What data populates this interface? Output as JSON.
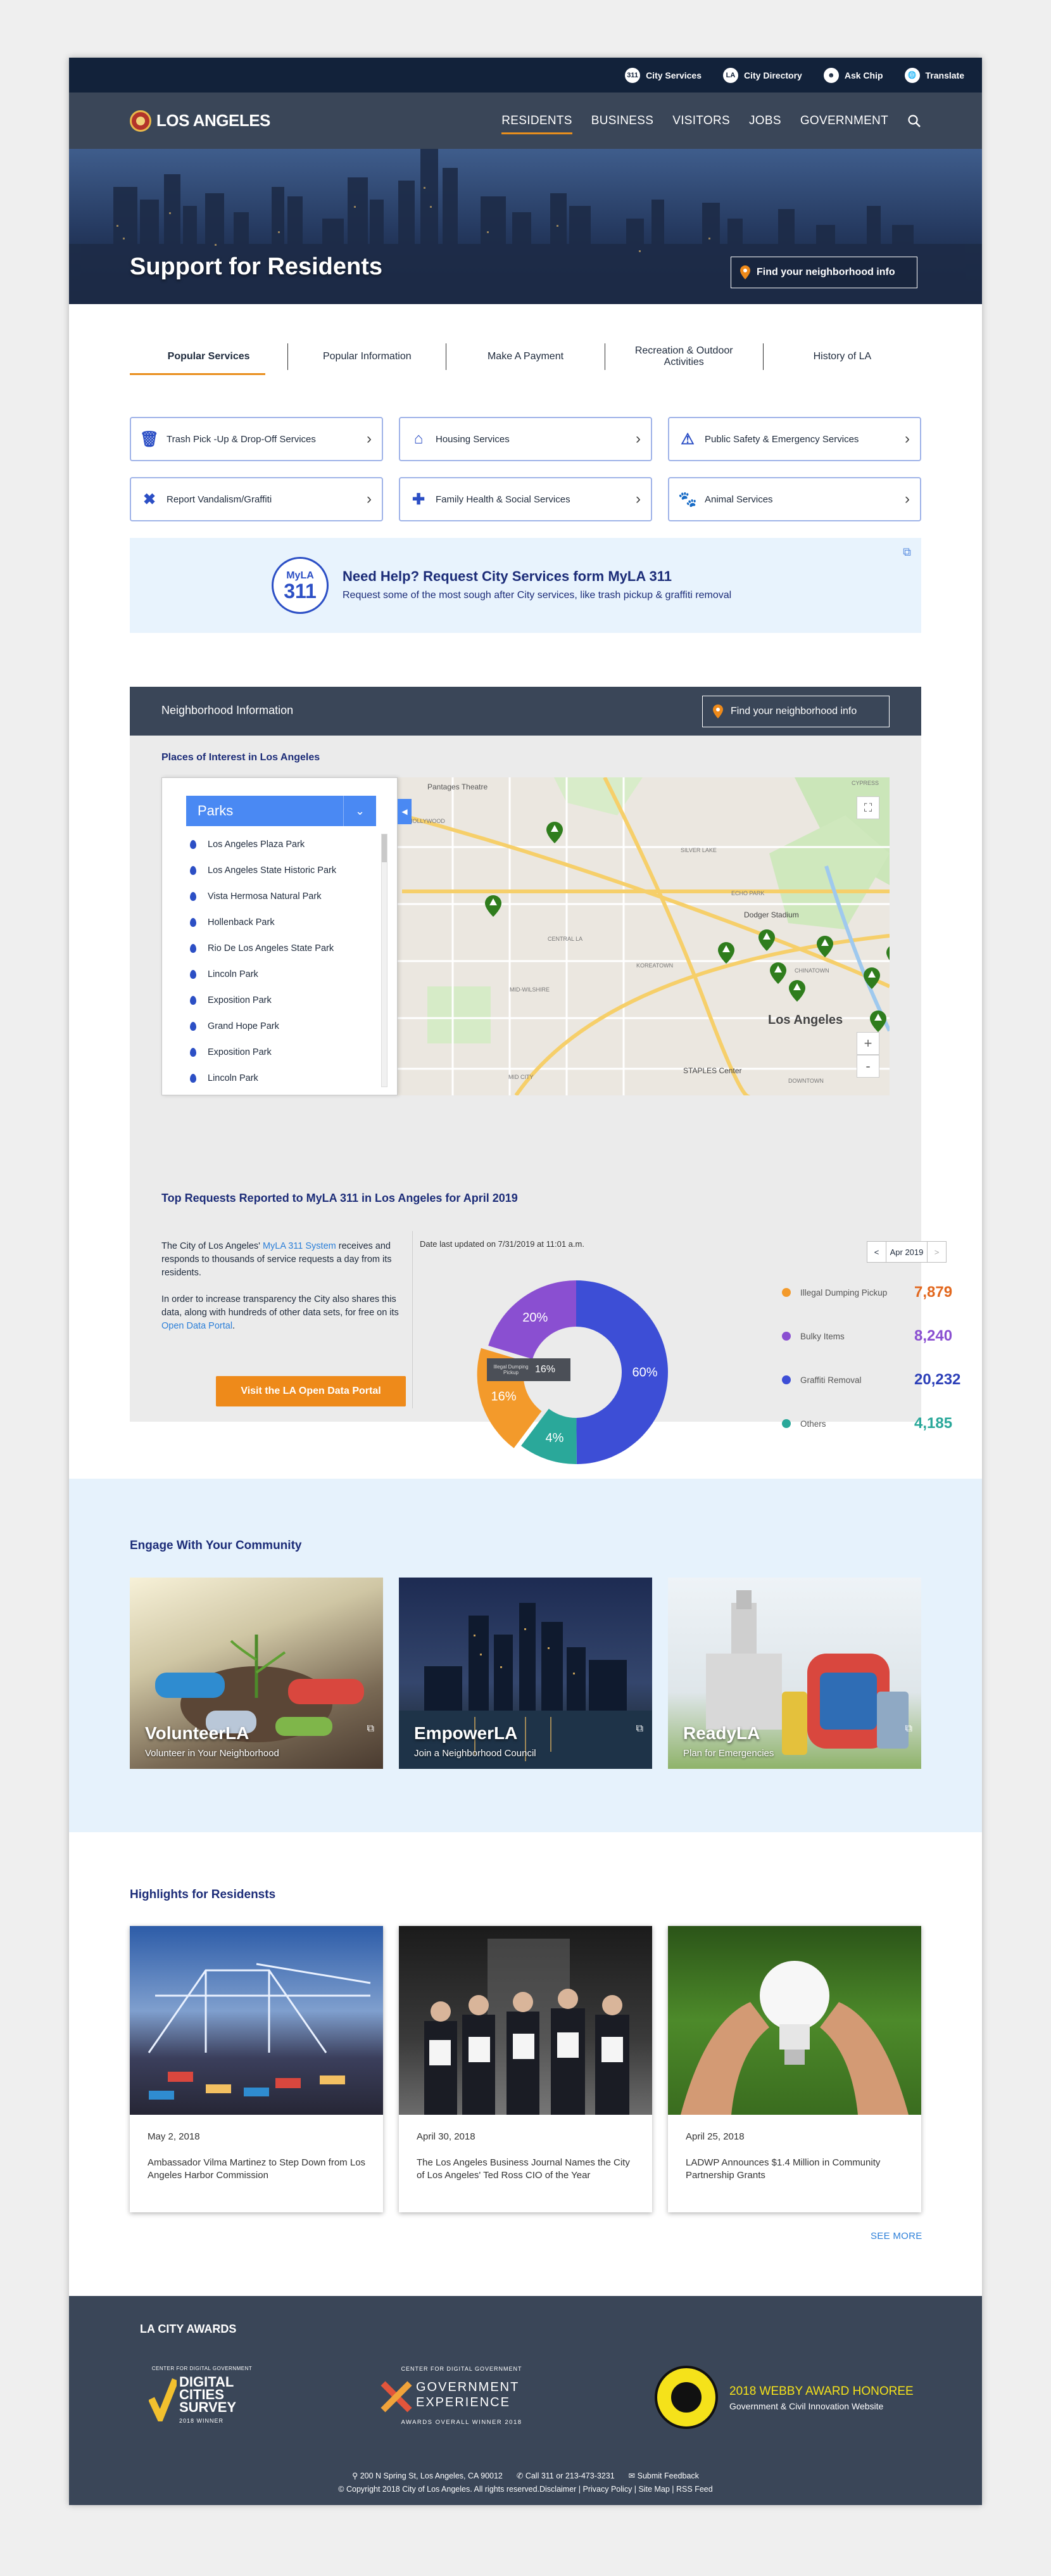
{
  "utility": {
    "links": [
      {
        "icon": "311-icon",
        "glyph": "311",
        "label": "City Services"
      },
      {
        "icon": "city-directory-icon",
        "glyph": "LA",
        "label": "City Directory"
      },
      {
        "icon": "chip-icon",
        "glyph": "☻",
        "label": "Ask Chip"
      },
      {
        "icon": "globe-icon",
        "glyph": "🌐",
        "label": "Translate"
      }
    ]
  },
  "header": {
    "logo_text": "LOS ANGELES",
    "nav": [
      "RESIDENTS",
      "BUSINESS",
      "VISITORS",
      "JOBS",
      "GOVERNMENT"
    ],
    "active_nav": "RESIDENTS"
  },
  "hero": {
    "title": "Support for Residents",
    "button_label": "Find your neighborhood info"
  },
  "tabs": [
    "Popular Services",
    "Popular Information",
    "Make A Payment",
    "Recreation & Outdoor Activities",
    "History of LA"
  ],
  "services": [
    {
      "label": "Trash Pick -Up & Drop-Off Services",
      "icon": "trash-icon"
    },
    {
      "label": "Housing Services",
      "icon": "house-icon"
    },
    {
      "label": "Public Safety & Emergency Services",
      "icon": "warning-icon"
    },
    {
      "label": "Report Vandalism/Graffiti",
      "icon": "x-icon"
    },
    {
      "label": "Family Health & Social Services",
      "icon": "plus-icon"
    },
    {
      "label": "Animal Services",
      "icon": "paw-icon"
    }
  ],
  "myla": {
    "logo_top": "MyLA",
    "logo_num": "311",
    "title": "Need Help? Request City Services form MyLA 311",
    "subtitle": "Request some of the most sough after City services, like trash pickup & graffiti removal"
  },
  "neighborhood": {
    "title": "Neighborhood Information",
    "button_label": "Find your neighborhood info",
    "poi_title": "Places of Interest in Los Angeles",
    "selected_category": "Parks",
    "parks": [
      "Los Angeles Plaza Park",
      "Los Angeles State Historic Park",
      "Vista Hermosa Natural Park",
      "Hollenback Park",
      "Rio De Los Angeles State Park",
      "Lincoln Park",
      "Exposition Park",
      "Grand Hope Park",
      "Exposition Park",
      "Lincoln Park"
    ],
    "map_labels": {
      "city": "Los Angeles",
      "pantages": "Pantages Theatre",
      "dodger": "Dodger Stadium",
      "staples": "STAPLES Center",
      "hollywood": "HOLLYWOOD",
      "koreatown": "KOREATOWN",
      "silverlake": "SILVER LAKE",
      "echopark": "ECHO PARK",
      "chinatown": "CHINATOWN",
      "cypress": "CYPRESS",
      "central": "CENTRAL LA",
      "midcity": "MID CITY",
      "wilshire": "MID-WILSHIRE",
      "downtown": "DOWNTOWN"
    }
  },
  "requests": {
    "title": "Top Requests Reported to MyLA 311 in Los Angeles for April 2019",
    "p1_a": "The City of Los Angeles' ",
    "p1_link": "MyLA 311 System",
    "p1_b": " receives and responds to thousands of service requests a day from its residents.",
    "p2_a": "In order to increase transparency the City also shares this data, along with hundreds of other data sets, for free on its ",
    "p2_link": "Open Data Portal",
    "p2_b": ".",
    "button_label": "Visit the LA Open Data Portal",
    "date_note": "Date last updated on 7/31/2019 at 11:01 a.m.",
    "month": "Apr 2019",
    "tooltip_label": "Illegal Dumping Pickup",
    "tooltip_value": "16%"
  },
  "chart_data": {
    "type": "pie",
    "title": "",
    "categories": [
      "Illegal Dumping Pickup",
      "Bulky Items",
      "Graffiti Removal",
      "Others"
    ],
    "values": [
      7879,
      8240,
      20232,
      4185
    ],
    "percent_labels": [
      "16%",
      "20%",
      "60%",
      "4%"
    ],
    "colors": [
      "#f39a2b",
      "#8a4fd1",
      "#3d4ed6",
      "#2aa89a"
    ]
  },
  "engage": {
    "title": "Engage With Your Community",
    "cards": [
      {
        "name": "VolunteerLA",
        "sub": "Volunteer in Your Neighborhood"
      },
      {
        "name": "EmpowerLA",
        "sub": "Join a Neighborhood Council"
      },
      {
        "name": "ReadyLA",
        "sub": "Plan for Emergencies"
      }
    ]
  },
  "highlights": {
    "title": "Highlights for Residensts",
    "cards": [
      {
        "date": "May 2, 2018",
        "text": "Ambassador Vilma Martinez to Step Down from Los Angeles Harbor Commission"
      },
      {
        "date": "April 30, 2018",
        "text": "The Los Angeles Business Journal Names the City of Los Angeles' Ted Ross CIO of the Year"
      },
      {
        "date": "April 25, 2018",
        "text": "LADWP Announces $1.4 Million in Community Partnership Grants"
      }
    ],
    "see_more": "SEE MORE"
  },
  "footer": {
    "awards_title": "LA CITY AWARDS",
    "award1": {
      "top": "CENTER FOR DIGITAL GOVERNMENT",
      "line1": "DIGITAL",
      "line2": "CITIES",
      "line3": "SURVEY",
      "year": "2018 WINNER"
    },
    "award2": {
      "top": "CENTER FOR DIGITAL GOVERNMENT",
      "line1": "GOVERNMENT",
      "line2": "EXPERIENCE",
      "bottom": "AWARDS OVERALL WINNER 2018"
    },
    "award3": {
      "title": "2018 WEBBY AWARD HONOREE",
      "sub": "Government & Civil Innovation Website"
    },
    "address": "200 N Spring St, Los Angeles, CA 90012",
    "phone": "Call 311 or 213-473-3231",
    "feedback": "Submit Feedback",
    "copyright": "© Copyright 2018 City of Los Angeles. All rights reserved.Disclaimer | Privacy Policy | Site Map | RSS Feed"
  }
}
